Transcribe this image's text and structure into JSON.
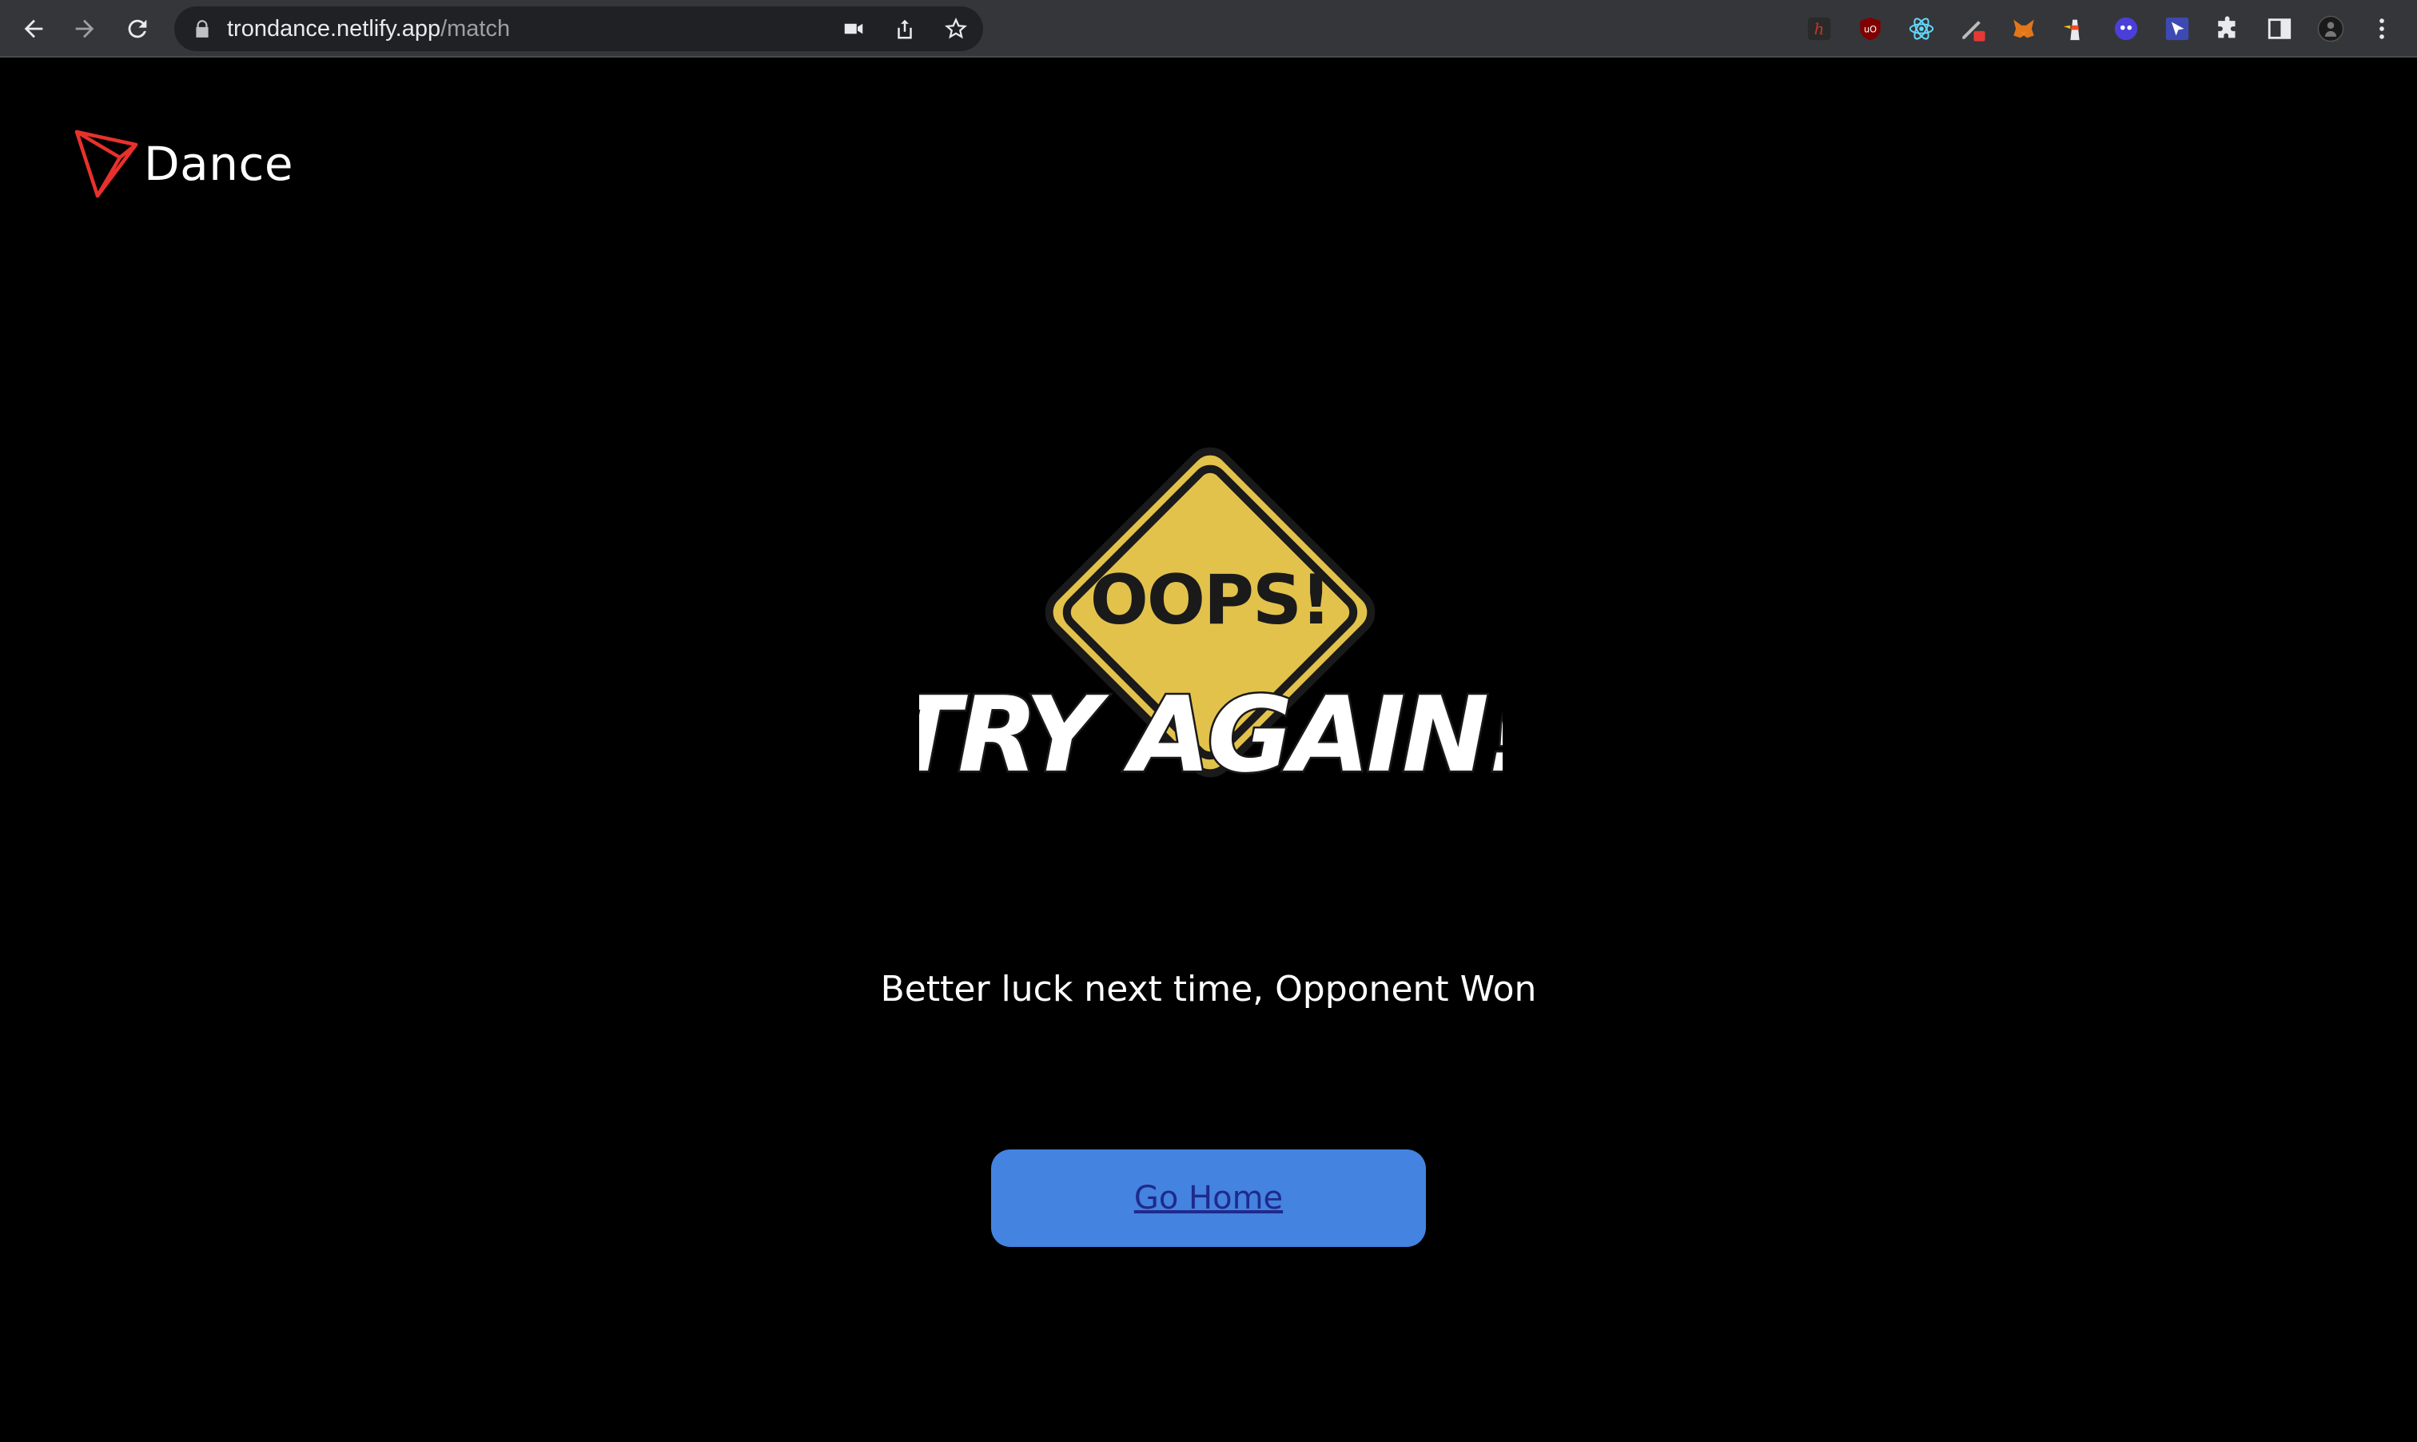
{
  "browser": {
    "url_host": "trondance.netlify.app",
    "url_path": "/match",
    "toolbar_icons": [
      "back-icon",
      "forward-icon",
      "reload-icon"
    ],
    "omnibox_icons": [
      "camera-icon",
      "share-icon",
      "bookmark-star-icon"
    ],
    "extensions": [
      "hypothesis-extension-icon",
      "ublock-extension-icon",
      "react-devtools-extension-icon",
      "pen-extension-icon",
      "metamask-extension-icon",
      "lighthouse-extension-icon",
      "ghost-extension-icon",
      "cursor-extension-icon",
      "puzzle-extensions-icon",
      "side-panel-icon",
      "profile-avatar",
      "menu-kebab-icon"
    ]
  },
  "header": {
    "brand_name": "Dance",
    "logo_color": "#e8312c"
  },
  "hero": {
    "sign_text_top": "OOPS!",
    "sign_text_bottom": "TRY AGAIN!",
    "sign_color": "#e2c24b"
  },
  "result": {
    "message": "Better luck next time, Opponent Won"
  },
  "actions": {
    "go_home_label": "Go Home",
    "button_color": "#4483e0"
  }
}
